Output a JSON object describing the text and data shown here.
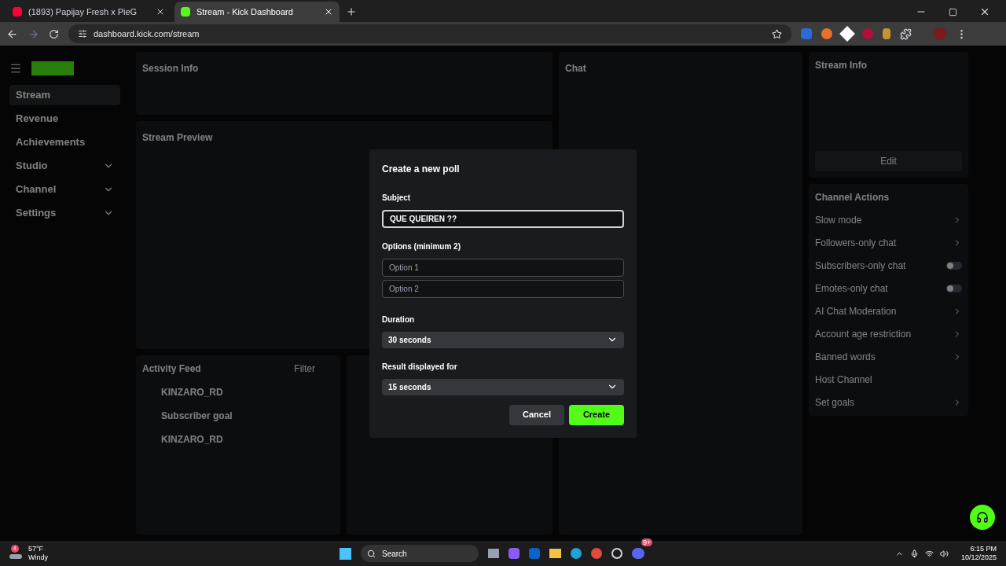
{
  "browser": {
    "tabs": [
      {
        "title": "(1893) Papijay Fresh x PieG",
        "selected": false
      },
      {
        "title": "Stream - Kick Dashboard",
        "selected": true
      }
    ],
    "url": "dashboard.kick.com/stream"
  },
  "sidebar": {
    "items": [
      {
        "label": "Stream",
        "selected": true,
        "expandable": false
      },
      {
        "label": "Revenue",
        "selected": false,
        "expandable": false
      },
      {
        "label": "Achievements",
        "selected": false,
        "expandable": false
      },
      {
        "label": "Studio",
        "selected": false,
        "expandable": true
      },
      {
        "label": "Channel",
        "selected": false,
        "expandable": true
      },
      {
        "label": "Settings",
        "selected": false,
        "expandable": true
      }
    ]
  },
  "session_info": {
    "title": "Session Info"
  },
  "stream_preview": {
    "title": "Stream Preview"
  },
  "activity_feed": {
    "title": "Activity Feed",
    "filter": "Filter",
    "items": [
      {
        "user": "KINZARO_RD"
      },
      {
        "user": "Subscriber goal"
      },
      {
        "user": "KINZARO_RD"
      }
    ]
  },
  "chat": {
    "title": "Chat"
  },
  "stream_info": {
    "title": "Stream Info",
    "edit": "Edit"
  },
  "channel_actions": {
    "title": "Channel Actions",
    "items": [
      {
        "label": "Slow mode",
        "kind": "link"
      },
      {
        "label": "Followers-only chat",
        "kind": "link"
      },
      {
        "label": "Subscribers-only chat",
        "kind": "toggle",
        "on": false
      },
      {
        "label": "Emotes-only chat",
        "kind": "toggle",
        "on": false
      },
      {
        "label": "AI Chat Moderation",
        "kind": "link"
      },
      {
        "label": "Account age restriction",
        "kind": "link"
      },
      {
        "label": "Banned words",
        "kind": "link"
      },
      {
        "label": "Host Channel",
        "kind": "plain"
      },
      {
        "label": "Set goals",
        "kind": "link"
      }
    ]
  },
  "dialog": {
    "title": "Create a new poll",
    "subject_label": "Subject",
    "subject_value": "QUE QUEIREN ??",
    "options_label": "Options (minimum 2)",
    "options": [
      {
        "placeholder": "Option 1"
      },
      {
        "placeholder": "Option 2"
      }
    ],
    "duration_label": "Duration",
    "duration": "30 seconds",
    "result_label": "Result displayed for",
    "result": "15 seconds",
    "cancel": "Cancel",
    "create": "Create"
  },
  "taskbar": {
    "weather_badge": "4",
    "temperature": "57°F",
    "condition": "Windy",
    "search": "Search",
    "discord_badge": "9+",
    "time": "6:15 PM",
    "date": "10/12/2025"
  }
}
